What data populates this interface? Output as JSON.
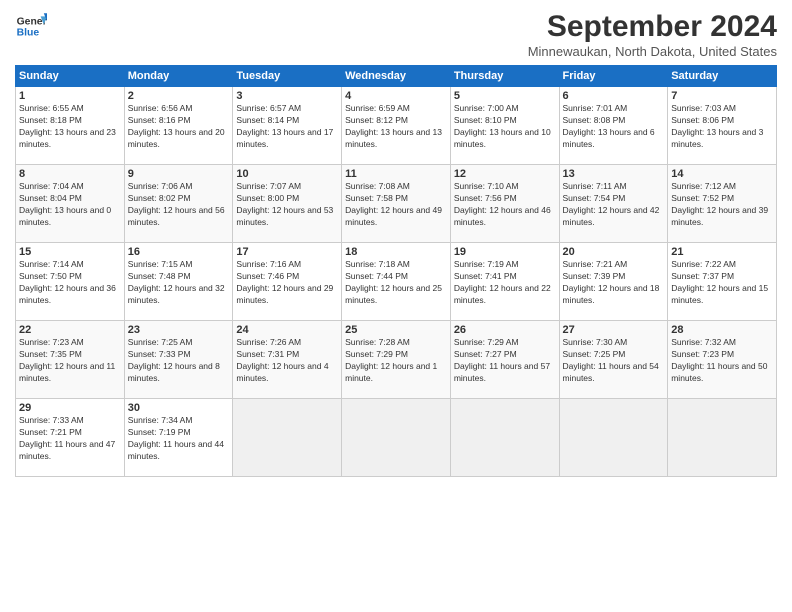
{
  "header": {
    "logo_line1": "General",
    "logo_line2": "Blue",
    "month": "September 2024",
    "location": "Minnewaukan, North Dakota, United States"
  },
  "weekdays": [
    "Sunday",
    "Monday",
    "Tuesday",
    "Wednesday",
    "Thursday",
    "Friday",
    "Saturday"
  ],
  "weeks": [
    [
      {
        "day": "1",
        "sunrise": "6:55 AM",
        "sunset": "8:18 PM",
        "daylight": "13 hours and 23 minutes."
      },
      {
        "day": "2",
        "sunrise": "6:56 AM",
        "sunset": "8:16 PM",
        "daylight": "13 hours and 20 minutes."
      },
      {
        "day": "3",
        "sunrise": "6:57 AM",
        "sunset": "8:14 PM",
        "daylight": "13 hours and 17 minutes."
      },
      {
        "day": "4",
        "sunrise": "6:59 AM",
        "sunset": "8:12 PM",
        "daylight": "13 hours and 13 minutes."
      },
      {
        "day": "5",
        "sunrise": "7:00 AM",
        "sunset": "8:10 PM",
        "daylight": "13 hours and 10 minutes."
      },
      {
        "day": "6",
        "sunrise": "7:01 AM",
        "sunset": "8:08 PM",
        "daylight": "13 hours and 6 minutes."
      },
      {
        "day": "7",
        "sunrise": "7:03 AM",
        "sunset": "8:06 PM",
        "daylight": "13 hours and 3 minutes."
      }
    ],
    [
      {
        "day": "8",
        "sunrise": "7:04 AM",
        "sunset": "8:04 PM",
        "daylight": "13 hours and 0 minutes."
      },
      {
        "day": "9",
        "sunrise": "7:06 AM",
        "sunset": "8:02 PM",
        "daylight": "12 hours and 56 minutes."
      },
      {
        "day": "10",
        "sunrise": "7:07 AM",
        "sunset": "8:00 PM",
        "daylight": "12 hours and 53 minutes."
      },
      {
        "day": "11",
        "sunrise": "7:08 AM",
        "sunset": "7:58 PM",
        "daylight": "12 hours and 49 minutes."
      },
      {
        "day": "12",
        "sunrise": "7:10 AM",
        "sunset": "7:56 PM",
        "daylight": "12 hours and 46 minutes."
      },
      {
        "day": "13",
        "sunrise": "7:11 AM",
        "sunset": "7:54 PM",
        "daylight": "12 hours and 42 minutes."
      },
      {
        "day": "14",
        "sunrise": "7:12 AM",
        "sunset": "7:52 PM",
        "daylight": "12 hours and 39 minutes."
      }
    ],
    [
      {
        "day": "15",
        "sunrise": "7:14 AM",
        "sunset": "7:50 PM",
        "daylight": "12 hours and 36 minutes."
      },
      {
        "day": "16",
        "sunrise": "7:15 AM",
        "sunset": "7:48 PM",
        "daylight": "12 hours and 32 minutes."
      },
      {
        "day": "17",
        "sunrise": "7:16 AM",
        "sunset": "7:46 PM",
        "daylight": "12 hours and 29 minutes."
      },
      {
        "day": "18",
        "sunrise": "7:18 AM",
        "sunset": "7:44 PM",
        "daylight": "12 hours and 25 minutes."
      },
      {
        "day": "19",
        "sunrise": "7:19 AM",
        "sunset": "7:41 PM",
        "daylight": "12 hours and 22 minutes."
      },
      {
        "day": "20",
        "sunrise": "7:21 AM",
        "sunset": "7:39 PM",
        "daylight": "12 hours and 18 minutes."
      },
      {
        "day": "21",
        "sunrise": "7:22 AM",
        "sunset": "7:37 PM",
        "daylight": "12 hours and 15 minutes."
      }
    ],
    [
      {
        "day": "22",
        "sunrise": "7:23 AM",
        "sunset": "7:35 PM",
        "daylight": "12 hours and 11 minutes."
      },
      {
        "day": "23",
        "sunrise": "7:25 AM",
        "sunset": "7:33 PM",
        "daylight": "12 hours and 8 minutes."
      },
      {
        "day": "24",
        "sunrise": "7:26 AM",
        "sunset": "7:31 PM",
        "daylight": "12 hours and 4 minutes."
      },
      {
        "day": "25",
        "sunrise": "7:28 AM",
        "sunset": "7:29 PM",
        "daylight": "12 hours and 1 minute."
      },
      {
        "day": "26",
        "sunrise": "7:29 AM",
        "sunset": "7:27 PM",
        "daylight": "11 hours and 57 minutes."
      },
      {
        "day": "27",
        "sunrise": "7:30 AM",
        "sunset": "7:25 PM",
        "daylight": "11 hours and 54 minutes."
      },
      {
        "day": "28",
        "sunrise": "7:32 AM",
        "sunset": "7:23 PM",
        "daylight": "11 hours and 50 minutes."
      }
    ],
    [
      {
        "day": "29",
        "sunrise": "7:33 AM",
        "sunset": "7:21 PM",
        "daylight": "11 hours and 47 minutes."
      },
      {
        "day": "30",
        "sunrise": "7:34 AM",
        "sunset": "7:19 PM",
        "daylight": "11 hours and 44 minutes."
      },
      null,
      null,
      null,
      null,
      null
    ]
  ]
}
